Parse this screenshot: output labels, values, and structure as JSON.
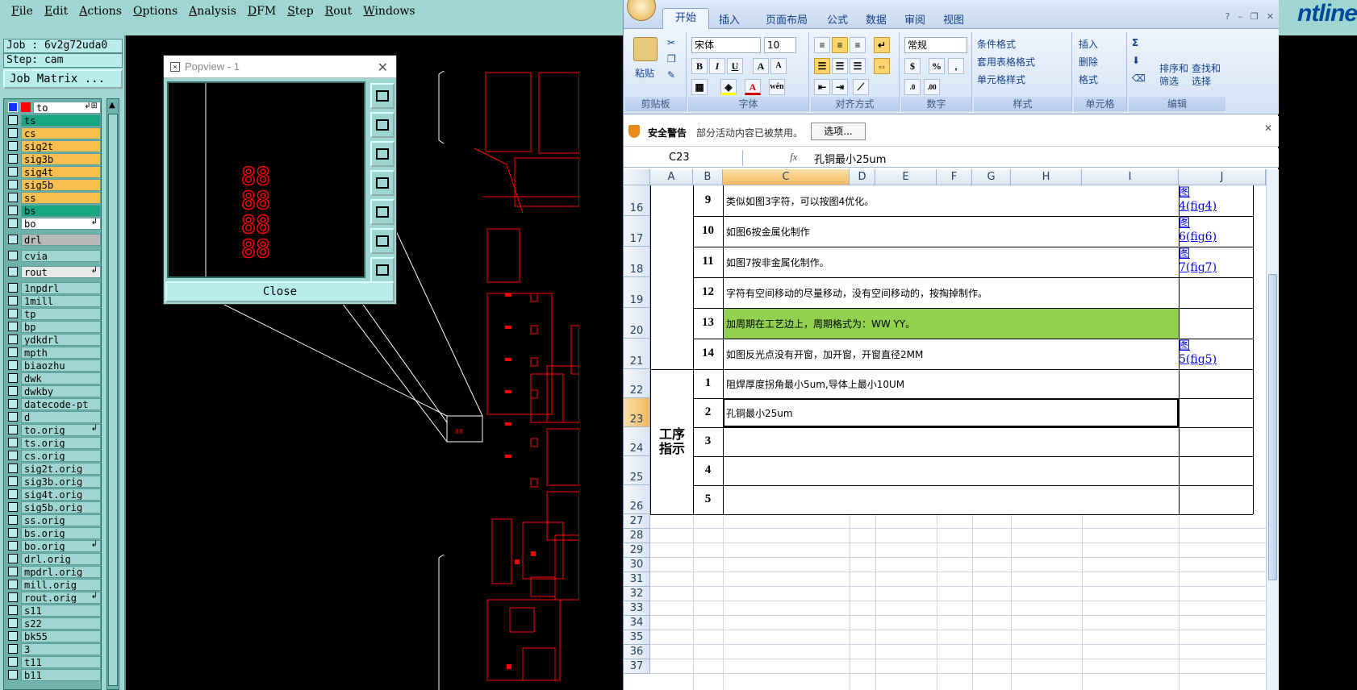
{
  "cam": {
    "menu": [
      "File",
      "Edit",
      "Actions",
      "Options",
      "Analysis",
      "DFM",
      "Step",
      "Rout",
      "Windows"
    ],
    "brand": "ntline",
    "job_line": "Job : 6v2g72uda0",
    "step_line": "Step: cam",
    "job_matrix_label": "Job Matrix ...",
    "layers": [
      {
        "name": "to",
        "color": "#ffffff",
        "on": true,
        "mark": "↲⊞"
      },
      {
        "name": "ts",
        "color": "#1aa682"
      },
      {
        "name": "cs",
        "color": "#f6c04e"
      },
      {
        "name": "sig2t",
        "color": "#f6c04e"
      },
      {
        "name": "sig3b",
        "color": "#f6c04e"
      },
      {
        "name": "sig4t",
        "color": "#f6c04e"
      },
      {
        "name": "sig5b",
        "color": "#f6c04e"
      },
      {
        "name": "ss",
        "color": "#f6c04e"
      },
      {
        "name": "bs",
        "color": "#1aa682"
      },
      {
        "name": "bo",
        "color": "#ffffff",
        "mark": "↲"
      },
      {
        "name": "drl",
        "color": "#b9b9b9",
        "gap": true
      },
      {
        "name": "cvia",
        "color": "#9fd6d2",
        "gap": true
      },
      {
        "name": "rout",
        "color": "#e8e8e8",
        "gap": true,
        "mark": "↲"
      },
      {
        "name": "1npdrl",
        "color": "#9fd6d2",
        "gap": true
      },
      {
        "name": "1mill",
        "color": "#9fd6d2"
      },
      {
        "name": "tp",
        "color": "#9fd6d2"
      },
      {
        "name": "bp",
        "color": "#9fd6d2"
      },
      {
        "name": "ydkdrl",
        "color": "#9fd6d2"
      },
      {
        "name": "mpth",
        "color": "#9fd6d2"
      },
      {
        "name": "biaozhu",
        "color": "#9fd6d2"
      },
      {
        "name": "dwk",
        "color": "#9fd6d2"
      },
      {
        "name": "dwkby",
        "color": "#9fd6d2"
      },
      {
        "name": "datecode-pt",
        "color": "#9fd6d2"
      },
      {
        "name": "d",
        "color": "#9fd6d2"
      },
      {
        "name": "to.orig",
        "color": "#9fd6d2",
        "mark": "↲"
      },
      {
        "name": "ts.orig",
        "color": "#9fd6d2"
      },
      {
        "name": "cs.orig",
        "color": "#9fd6d2"
      },
      {
        "name": "sig2t.orig",
        "color": "#9fd6d2"
      },
      {
        "name": "sig3b.orig",
        "color": "#9fd6d2"
      },
      {
        "name": "sig4t.orig",
        "color": "#9fd6d2"
      },
      {
        "name": "sig5b.orig",
        "color": "#9fd6d2"
      },
      {
        "name": "ss.orig",
        "color": "#9fd6d2"
      },
      {
        "name": "bs.orig",
        "color": "#9fd6d2"
      },
      {
        "name": "bo.orig",
        "color": "#9fd6d2",
        "mark": "↲"
      },
      {
        "name": "drl.orig",
        "color": "#9fd6d2"
      },
      {
        "name": "mpdrl.orig",
        "color": "#9fd6d2"
      },
      {
        "name": "mill.orig",
        "color": "#9fd6d2"
      },
      {
        "name": "rout.orig",
        "color": "#9fd6d2",
        "mark": "↲"
      },
      {
        "name": "s11",
        "color": "#9fd6d2"
      },
      {
        "name": "s22",
        "color": "#9fd6d2"
      },
      {
        "name": "bk55",
        "color": "#9fd6d2"
      },
      {
        "name": "3",
        "color": "#9fd6d2"
      },
      {
        "name": "t11",
        "color": "#9fd6d2"
      },
      {
        "name": "b11",
        "color": "#9fd6d2"
      }
    ],
    "popview": {
      "title": "Popview - 1",
      "close_label": "Close",
      "text": "88"
    }
  },
  "excel": {
    "tabs": [
      "开始",
      "插入",
      "页面布局",
      "公式",
      "数据",
      "审阅",
      "视图"
    ],
    "groups": [
      "剪贴板",
      "字体",
      "对齐方式",
      "数字",
      "样式",
      "单元格",
      "编辑"
    ],
    "paste_label": "粘贴",
    "font_name": "宋体",
    "font_size": "10",
    "number_format": "常规",
    "style_items": [
      "条件格式",
      "套用表格格式",
      "单元格样式"
    ],
    "cell_items": [
      "插入",
      "删除",
      "格式"
    ],
    "edit_items": [
      "排序和",
      "筛选",
      "查找和",
      "选择"
    ],
    "security": {
      "title": "安全警告",
      "message": "部分活动内容已被禁用。",
      "options_label": "选项..."
    },
    "name_box": "C23",
    "fx": "fx",
    "formula": "孔铜最小25um",
    "columns": [
      "A",
      "B",
      "C",
      "D",
      "E",
      "F",
      "G",
      "H",
      "I",
      "J"
    ],
    "row_numbers": [
      "16",
      "17",
      "18",
      "19",
      "20",
      "21",
      "22",
      "23",
      "24",
      "25",
      "26",
      "27",
      "28",
      "29",
      "30",
      "31",
      "32",
      "33",
      "34",
      "35",
      "36",
      "37"
    ],
    "rows": [
      {
        "num": "9",
        "text": "类似如图3字符，可以按图4优化。",
        "link": [
          "图",
          "4(fig4)"
        ]
      },
      {
        "num": "10",
        "text": "如图6按金属化制作",
        "link": [
          "图",
          "6(fig6)"
        ]
      },
      {
        "num": "11",
        "text": "如图7按非金属化制作。",
        "link": [
          "图",
          "7(fig7)"
        ]
      },
      {
        "num": "12",
        "text": "字符有空间移动的尽量移动，没有空间移动的，按掏掉制作。"
      },
      {
        "num": "13",
        "text": "加周期在工艺边上，周期格式为：WW YY。",
        "highlight": "#92d050"
      },
      {
        "num": "14",
        "text": "如图反光点没有开窗，加开窗，开窗直径2MM",
        "link": [
          "图",
          "5(fig5)"
        ]
      },
      {
        "num": "1",
        "text": "阻焊厚度拐角最小5um,导体上最小10UM"
      },
      {
        "num": "2",
        "text": "孔铜最小25um"
      },
      {
        "num": "3",
        "text": ""
      },
      {
        "num": "4",
        "text": ""
      },
      {
        "num": "5",
        "text": ""
      }
    ],
    "section_label": [
      "工序",
      "指示"
    ]
  }
}
